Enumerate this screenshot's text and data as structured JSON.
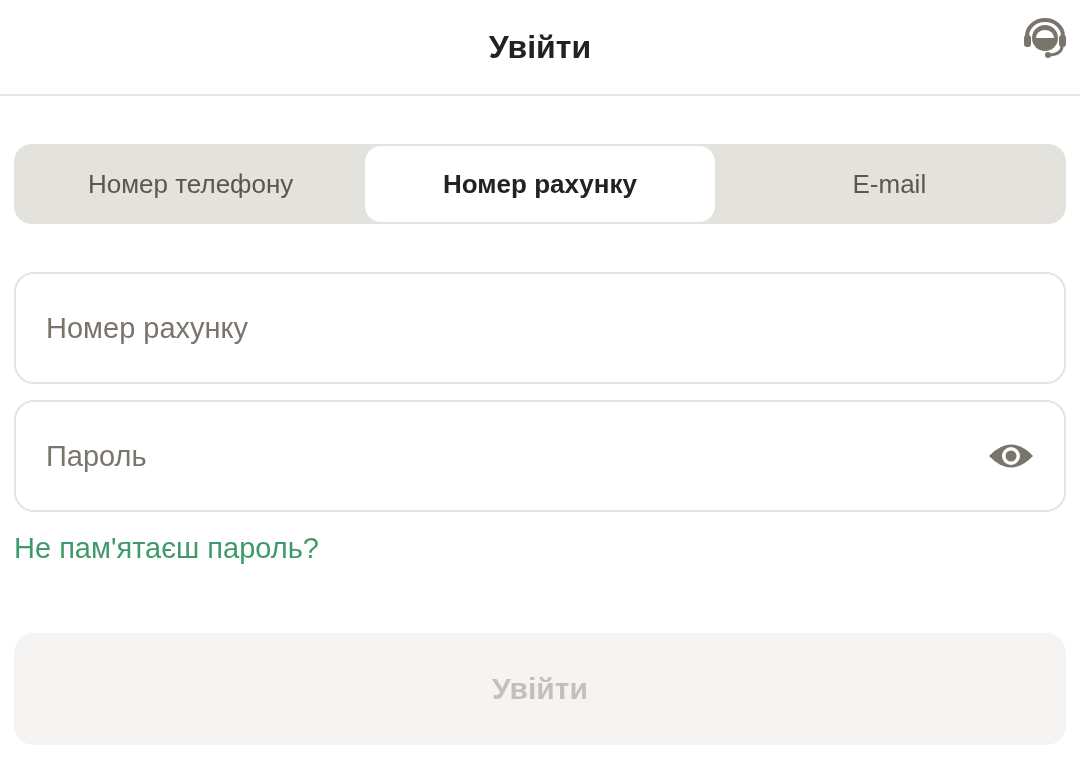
{
  "header": {
    "title": "Увійти"
  },
  "tabs": [
    {
      "label": "Номер телефону",
      "selected": false
    },
    {
      "label": "Номер рахунку",
      "selected": true
    },
    {
      "label": "E-mail",
      "selected": false
    }
  ],
  "fields": [
    {
      "placeholder": "Номер рахунку",
      "kind": "text"
    },
    {
      "placeholder": "Пароль",
      "kind": "password"
    }
  ],
  "forgot_link": "Не пам'ятаєш пароль?",
  "submit": {
    "label": "Увійти",
    "disabled": true
  }
}
